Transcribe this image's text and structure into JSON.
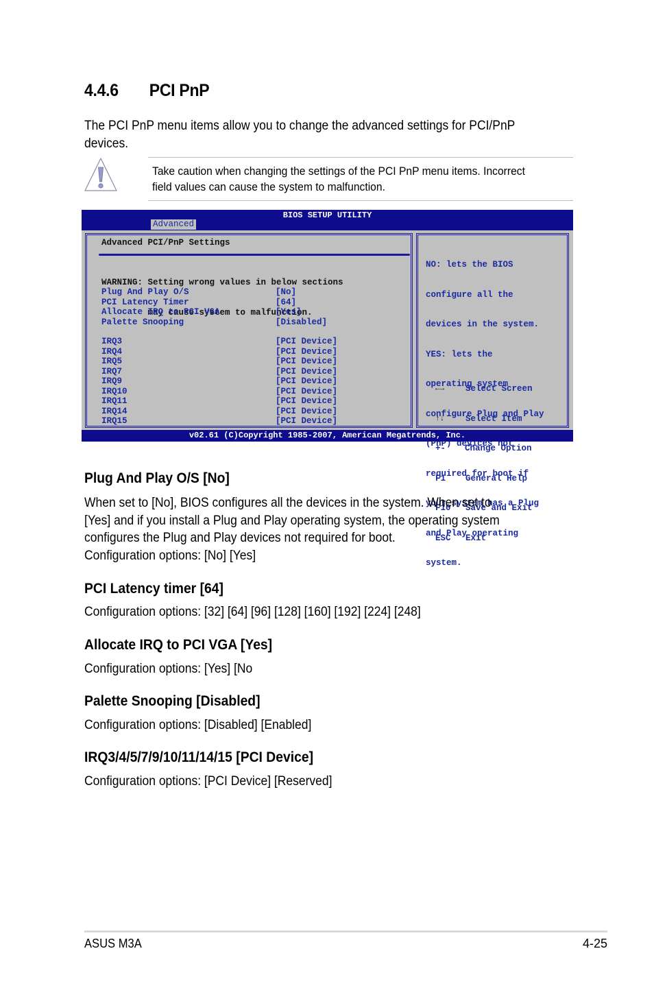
{
  "section": {
    "number": "4.4.6",
    "title": "PCI PnP",
    "intro_line1": "The PCI PnP menu items allow you to change the advanced settings for PCI/PnP",
    "intro_line2": "devices."
  },
  "caution": {
    "icon": "warning-triangle-icon",
    "line1": "Take caution when changing the settings of the PCI PnP menu items. Incorrect",
    "line2": "field values can cause the system to malfunction."
  },
  "bios": {
    "title": "BIOS SETUP UTILITY",
    "active_tab": "Advanced",
    "pane_title": "Advanced PCI/PnP Settings",
    "warning_line1": "WARNING: Setting wrong values in below sections",
    "warning_line2": "         may cause system to malfunction.",
    "settings": [
      {
        "label": "Plug And Play O/S",
        "value": "[No]"
      },
      {
        "label": "PCI Latency Timer",
        "value": "[64]"
      },
      {
        "label": "Allocate IRQ to PCI VGA",
        "value": "[Yes]"
      },
      {
        "label": "Palette Snooping",
        "value": "[Disabled]"
      }
    ],
    "irqs": [
      {
        "label": "IRQ3",
        "value": "[PCI Device]"
      },
      {
        "label": "IRQ4",
        "value": "[PCI Device]"
      },
      {
        "label": "IRQ5",
        "value": "[PCI Device]"
      },
      {
        "label": "IRQ7",
        "value": "[PCI Device]"
      },
      {
        "label": "IRQ9",
        "value": "[PCI Device]"
      },
      {
        "label": "IRQ10",
        "value": "[PCI Device]"
      },
      {
        "label": "IRQ11",
        "value": "[PCI Device]"
      },
      {
        "label": "IRQ14",
        "value": "[PCI Device]"
      },
      {
        "label": "IRQ15",
        "value": "[PCI Device]"
      }
    ],
    "help_lines": [
      "NO: lets the BIOS",
      "configure all the",
      "devices in the system.",
      "YES: lets the",
      "operating system",
      "configure Plug and Play",
      "(PnP) devices not",
      "required for boot if",
      "your system has a Plug",
      "and Play operating",
      "system."
    ],
    "keys": [
      {
        "key": "←→",
        "action": "Select Screen",
        "icon": "arrow-left-right-icon"
      },
      {
        "key": "↑↓",
        "action": "Select Item",
        "icon": "arrow-up-down-icon"
      },
      {
        "key": "+-",
        "action": "Change Option"
      },
      {
        "key": "F1",
        "action": "General Help"
      },
      {
        "key": "F10",
        "action": "Save and Exit"
      },
      {
        "key": "ESC",
        "action": "Exit"
      }
    ],
    "copyright": "v02.61 (C)Copyright 1985-2007, American Megatrends, Inc."
  },
  "items": [
    {
      "heading": "Plug And Play O/S [No]",
      "lines": [
        "When set to [No], BIOS configures all the devices in the system. When set to",
        "[Yes] and if you install a Plug and Play operating system, the operating system",
        "configures the Plug and Play devices not required for boot.",
        "Configuration options: [No] [Yes]"
      ]
    },
    {
      "heading": "PCI Latency timer [64]",
      "lines": [
        "Configuration options: [32] [64] [96] [128] [160] [192] [224] [248]"
      ]
    },
    {
      "heading": "Allocate IRQ to PCI VGA [Yes]",
      "lines": [
        "Configuration options: [Yes] [No"
      ]
    },
    {
      "heading": "Palette Snooping [Disabled]",
      "lines": [
        "Configuration options: [Disabled] [Enabled]"
      ]
    },
    {
      "heading": "IRQ3/4/5/7/9/10/11/14/15 [PCI Device]",
      "lines": [
        "Configuration options: [PCI Device] [Reserved]"
      ]
    }
  ],
  "footer": {
    "left": "ASUS M3A",
    "right": "4-25"
  },
  "colors": {
    "bios_blue": "#0c0c8c",
    "bios_gray": "#c0c0c0",
    "bios_text_blue": "#1a2aa0"
  }
}
